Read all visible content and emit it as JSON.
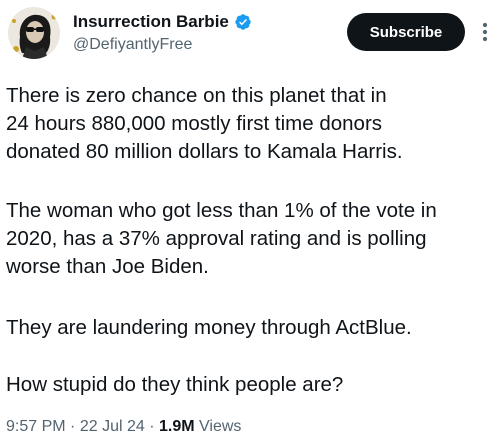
{
  "author": {
    "display_name": "Insurrection Barbie",
    "handle": "@DefiyantlyFree",
    "verified": true,
    "avatar_icon": "avatar-woman-sunglasses"
  },
  "actions": {
    "subscribe_label": "Subscribe",
    "more_icon": "more-vertical-icon"
  },
  "tweet": {
    "paragraphs": [
      "There is zero chance on this planet that in\n24 hours 880,000 mostly first time donors\ndonated 80 million dollars to Kamala Harris.",
      "The woman who got less than 1% of the vote in\n2020, has a 37% approval rating and is polling\nworse than Joe Biden.",
      "They are laundering money through ActBlue.",
      "How stupid do they think people are?"
    ]
  },
  "meta": {
    "time": "9:57 PM",
    "date": "22 Jul 24",
    "views_count": "1.9M",
    "views_label": "Views",
    "separator": "·"
  },
  "colors": {
    "text": "#0f1419",
    "secondary": "#536471",
    "verified": "#1d9bf0",
    "button_bg": "#0f1419",
    "button_text": "#ffffff"
  }
}
